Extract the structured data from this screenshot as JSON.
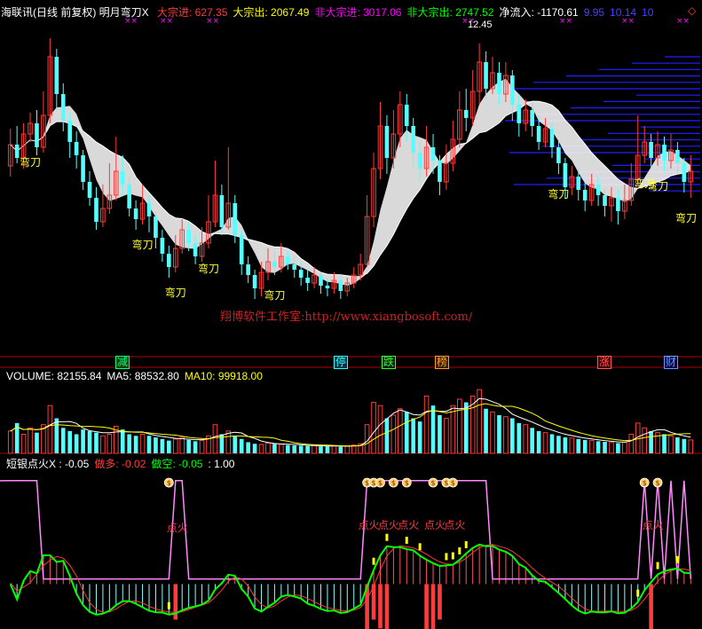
{
  "colors": {
    "bg": "#000000",
    "up": "#ff3b3b",
    "down": "#54ffff",
    "white": "#ffffff",
    "yellow": "#ffff00",
    "green": "#00ff00",
    "magenta": "#ff00ff",
    "pink": "#ff88ff",
    "blue": "#2020ff",
    "panel_line": "#b00000",
    "label_yellow": "#ffff33"
  },
  "main_header": {
    "title": "海联讯(日线 前复权) 明月弯刀X",
    "items": [
      {
        "label": "大宗进:",
        "value": "627.35",
        "color": "#ff3b3b"
      },
      {
        "label": "大宗出:",
        "value": "2067.49",
        "color": "#ffff00"
      },
      {
        "label": "非大宗进:",
        "value": "3017.06",
        "color": "#ff00ff"
      },
      {
        "label": "非大宗出:",
        "value": "2747.52",
        "color": "#00ff00"
      },
      {
        "label": "净流入:",
        "value": "-1170.61",
        "color": "#ffffff"
      },
      {
        "label": "",
        "value": "9.95",
        "color": "#4444ff"
      },
      {
        "label": "",
        "value": "10.14",
        "color": "#4444ff"
      },
      {
        "label": "",
        "value": "10",
        "color": "#4444ff"
      }
    ],
    "marker_glyph": "◇"
  },
  "watermark": "翔博软件工作室:http://www.xiangbosoft.com/",
  "peak_label": "12.45",
  "wandao_label": "弯刀",
  "event_badges": [
    {
      "text": "减",
      "color": "#00ff88",
      "bg": "#004400"
    },
    {
      "text": "停",
      "color": "#33ffff",
      "bg": "#003344"
    },
    {
      "text": "跌",
      "color": "#33ff33",
      "bg": "#002200"
    },
    {
      "text": "榜",
      "color": "#ff9933",
      "bg": "#332200"
    },
    {
      "text": "涨",
      "color": "#ff5555",
      "bg": "#440000"
    },
    {
      "text": "财",
      "color": "#6699ff",
      "bg": "#000044"
    }
  ],
  "volume_header": {
    "items": [
      {
        "label": "VOLUME:",
        "value": "82155.84",
        "color": "#ffffff"
      },
      {
        "label": "MA5:",
        "value": "88532.80",
        "color": "#ffffff"
      },
      {
        "label": "MA10:",
        "value": "99918.00",
        "color": "#ffff00"
      }
    ]
  },
  "indicator_header": {
    "items": [
      {
        "label": "短银点火X :",
        "value": "-0.05",
        "color": "#ffffff"
      },
      {
        "label": "做多:",
        "value": "-0.02",
        "color": "#ff3b3b"
      },
      {
        "label": "做空:",
        "value": "-0.05",
        "color": "#00ff00"
      },
      {
        "label": "",
        "value": ": 1.00",
        "color": "#ffffff"
      }
    ]
  },
  "indicator_labels": {
    "ignite": "点火",
    "coin": "$"
  },
  "chart_data": {
    "type": "candlestick",
    "symbol": "海联讯",
    "period": "日线 前复权",
    "price_range": [
      7.6,
      12.9
    ],
    "peak_value": 12.45,
    "candles": [
      [
        10.15,
        10.55,
        10.85,
        9.95
      ],
      [
        10.55,
        10.3,
        10.9,
        10.2
      ],
      [
        10.3,
        10.75,
        10.95,
        10.1
      ],
      [
        10.75,
        10.95,
        11.15,
        10.6
      ],
      [
        10.95,
        10.5,
        11.2,
        10.35
      ],
      [
        10.5,
        11.1,
        11.55,
        10.4
      ],
      [
        11.1,
        12.2,
        12.55,
        10.95
      ],
      [
        12.2,
        11.5,
        12.35,
        11.2
      ],
      [
        11.5,
        11.0,
        11.7,
        10.8
      ],
      [
        11.0,
        10.6,
        11.15,
        10.3
      ],
      [
        10.6,
        10.35,
        10.8,
        10.1
      ],
      [
        10.35,
        9.85,
        10.45,
        9.7
      ],
      [
        9.85,
        9.55,
        10.05,
        9.4
      ],
      [
        9.55,
        9.1,
        9.75,
        8.95
      ],
      [
        9.1,
        9.35,
        9.8,
        9.0
      ],
      [
        9.35,
        9.6,
        10.2,
        9.25
      ],
      [
        9.6,
        10.05,
        10.7,
        9.5
      ],
      [
        10.05,
        9.8,
        10.35,
        9.6
      ],
      [
        9.8,
        9.35,
        9.95,
        9.2
      ],
      [
        9.35,
        9.15,
        9.5,
        8.95
      ],
      [
        9.15,
        9.45,
        9.8,
        9.05
      ],
      [
        9.45,
        9.2,
        9.6,
        8.9
      ],
      [
        9.2,
        8.8,
        9.3,
        8.6
      ],
      [
        8.8,
        8.5,
        8.95,
        8.35
      ],
      [
        8.5,
        8.25,
        8.65,
        8.05
      ],
      [
        8.25,
        8.6,
        8.85,
        8.15
      ],
      [
        8.6,
        8.95,
        9.15,
        8.5
      ],
      [
        8.95,
        8.7,
        9.1,
        8.55
      ],
      [
        8.7,
        8.45,
        8.85,
        8.3
      ],
      [
        8.45,
        8.7,
        9.0,
        8.35
      ],
      [
        8.7,
        9.1,
        9.6,
        8.6
      ],
      [
        9.1,
        9.6,
        10.25,
        9.0
      ],
      [
        9.6,
        9.0,
        9.8,
        8.85
      ],
      [
        9.0,
        9.45,
        10.5,
        8.95
      ],
      [
        9.45,
        8.85,
        9.6,
        8.7
      ],
      [
        8.85,
        8.3,
        8.95,
        8.1
      ],
      [
        8.3,
        8.1,
        8.45,
        7.95
      ],
      [
        8.1,
        7.85,
        8.2,
        7.65
      ],
      [
        7.85,
        8.15,
        8.35,
        7.7
      ],
      [
        8.15,
        8.35,
        8.6,
        8.0
      ],
      [
        8.35,
        8.25,
        8.55,
        8.1
      ],
      [
        8.25,
        8.45,
        8.7,
        8.15
      ],
      [
        8.45,
        8.3,
        8.55,
        8.2
      ],
      [
        8.3,
        8.2,
        8.45,
        8.05
      ],
      [
        8.2,
        8.05,
        8.35,
        7.9
      ],
      [
        8.05,
        7.95,
        8.2,
        7.8
      ],
      [
        7.95,
        8.1,
        8.25,
        7.85
      ],
      [
        8.1,
        7.9,
        8.15,
        7.75
      ],
      [
        7.9,
        7.85,
        8.05,
        7.7
      ],
      [
        7.85,
        8.0,
        8.15,
        7.75
      ],
      [
        8.0,
        7.8,
        8.1,
        7.65
      ],
      [
        7.8,
        7.95,
        8.05,
        7.7
      ],
      [
        7.95,
        8.1,
        8.25,
        7.85
      ],
      [
        8.1,
        8.3,
        8.5,
        8.0
      ],
      [
        8.3,
        9.2,
        9.6,
        8.25
      ],
      [
        9.2,
        10.1,
        10.4,
        9.0
      ],
      [
        10.1,
        10.9,
        11.35,
        9.9
      ],
      [
        10.9,
        10.3,
        11.1,
        10.0
      ],
      [
        10.3,
        10.75,
        11.2,
        10.1
      ],
      [
        10.75,
        11.3,
        11.55,
        10.5
      ],
      [
        11.3,
        10.9,
        11.5,
        10.6
      ],
      [
        10.9,
        10.4,
        11.05,
        10.1
      ],
      [
        10.4,
        10.1,
        10.6,
        9.85
      ],
      [
        10.1,
        10.5,
        10.9,
        9.95
      ],
      [
        10.5,
        10.25,
        10.75,
        10.0
      ],
      [
        10.25,
        9.85,
        10.35,
        9.6
      ],
      [
        9.85,
        10.2,
        10.55,
        9.7
      ],
      [
        10.2,
        10.65,
        11.0,
        10.05
      ],
      [
        10.65,
        11.2,
        11.55,
        10.5
      ],
      [
        11.2,
        11.05,
        11.6,
        10.8
      ],
      [
        11.05,
        11.55,
        11.95,
        10.9
      ],
      [
        11.55,
        12.1,
        12.45,
        11.3
      ],
      [
        12.1,
        11.6,
        12.3,
        11.4
      ],
      [
        11.6,
        11.9,
        12.2,
        11.5
      ],
      [
        11.9,
        11.5,
        12.1,
        11.3
      ],
      [
        11.5,
        11.85,
        12.1,
        11.35
      ],
      [
        11.85,
        11.3,
        11.95,
        11.0
      ],
      [
        11.3,
        10.95,
        11.5,
        10.7
      ],
      [
        10.95,
        11.2,
        11.4,
        10.8
      ],
      [
        11.2,
        10.9,
        11.35,
        10.7
      ],
      [
        10.9,
        10.6,
        11.1,
        10.45
      ],
      [
        10.6,
        10.85,
        11.05,
        10.5
      ],
      [
        10.85,
        10.5,
        10.95,
        10.3
      ],
      [
        10.5,
        10.2,
        10.65,
        10.0
      ],
      [
        10.2,
        9.75,
        10.3,
        9.55
      ],
      [
        9.75,
        9.95,
        10.15,
        9.6
      ],
      [
        9.95,
        9.7,
        10.1,
        9.5
      ],
      [
        9.7,
        9.5,
        9.85,
        9.3
      ],
      [
        9.5,
        9.8,
        10.0,
        9.4
      ],
      [
        9.8,
        9.6,
        9.95,
        9.4
      ],
      [
        9.6,
        9.4,
        9.75,
        9.2
      ],
      [
        9.4,
        9.55,
        9.75,
        9.1
      ],
      [
        9.55,
        9.3,
        9.7,
        9.05
      ],
      [
        9.3,
        9.5,
        9.8,
        9.15
      ],
      [
        9.5,
        9.9,
        10.2,
        9.4
      ],
      [
        9.9,
        10.35,
        11.1,
        9.8
      ],
      [
        10.35,
        10.6,
        10.9,
        10.2
      ],
      [
        10.6,
        10.3,
        10.75,
        10.1
      ],
      [
        10.3,
        10.55,
        10.8,
        10.15
      ],
      [
        10.55,
        10.25,
        10.7,
        10.05
      ],
      [
        10.25,
        10.45,
        10.75,
        10.1
      ],
      [
        10.45,
        10.2,
        10.6,
        10.0
      ],
      [
        10.2,
        9.85,
        10.3,
        9.65
      ],
      [
        9.85,
        10.05,
        10.35,
        9.55
      ]
    ],
    "volume": {
      "range": [
        0,
        220000
      ],
      "values": [
        70000,
        95000,
        60000,
        80000,
        65000,
        90000,
        150000,
        110000,
        80000,
        70000,
        60000,
        75000,
        70000,
        65000,
        55000,
        60000,
        85000,
        75000,
        60000,
        55000,
        60000,
        55000,
        50000,
        45000,
        40000,
        45000,
        50000,
        42000,
        38000,
        40000,
        55000,
        90000,
        60000,
        70000,
        55000,
        45000,
        35000,
        30000,
        28000,
        32000,
        30000,
        28000,
        26000,
        25000,
        24000,
        23000,
        25000,
        22000,
        22000,
        24000,
        21000,
        23000,
        26000,
        30000,
        90000,
        160000,
        150000,
        110000,
        120000,
        140000,
        130000,
        110000,
        100000,
        180000,
        150000,
        120000,
        110000,
        150000,
        170000,
        160000,
        180000,
        200000,
        140000,
        130000,
        120000,
        115000,
        110000,
        95000,
        90000,
        80000,
        70000,
        65000,
        60000,
        55000,
        50000,
        48000,
        45000,
        42000,
        40000,
        38000,
        36000,
        34000,
        32000,
        35000,
        60000,
        95000,
        80000,
        70000,
        65000,
        60000,
        55000,
        50000,
        45000,
        42000
      ],
      "ma5_last": 88532.8,
      "ma10_last": 99918.0,
      "volume_last": 82155.84
    },
    "indicator": {
      "range": [
        -0.4,
        1.05
      ],
      "main_last": -0.05,
      "long_last": -0.02,
      "short_last": -0.05,
      "level": 1.0
    }
  }
}
